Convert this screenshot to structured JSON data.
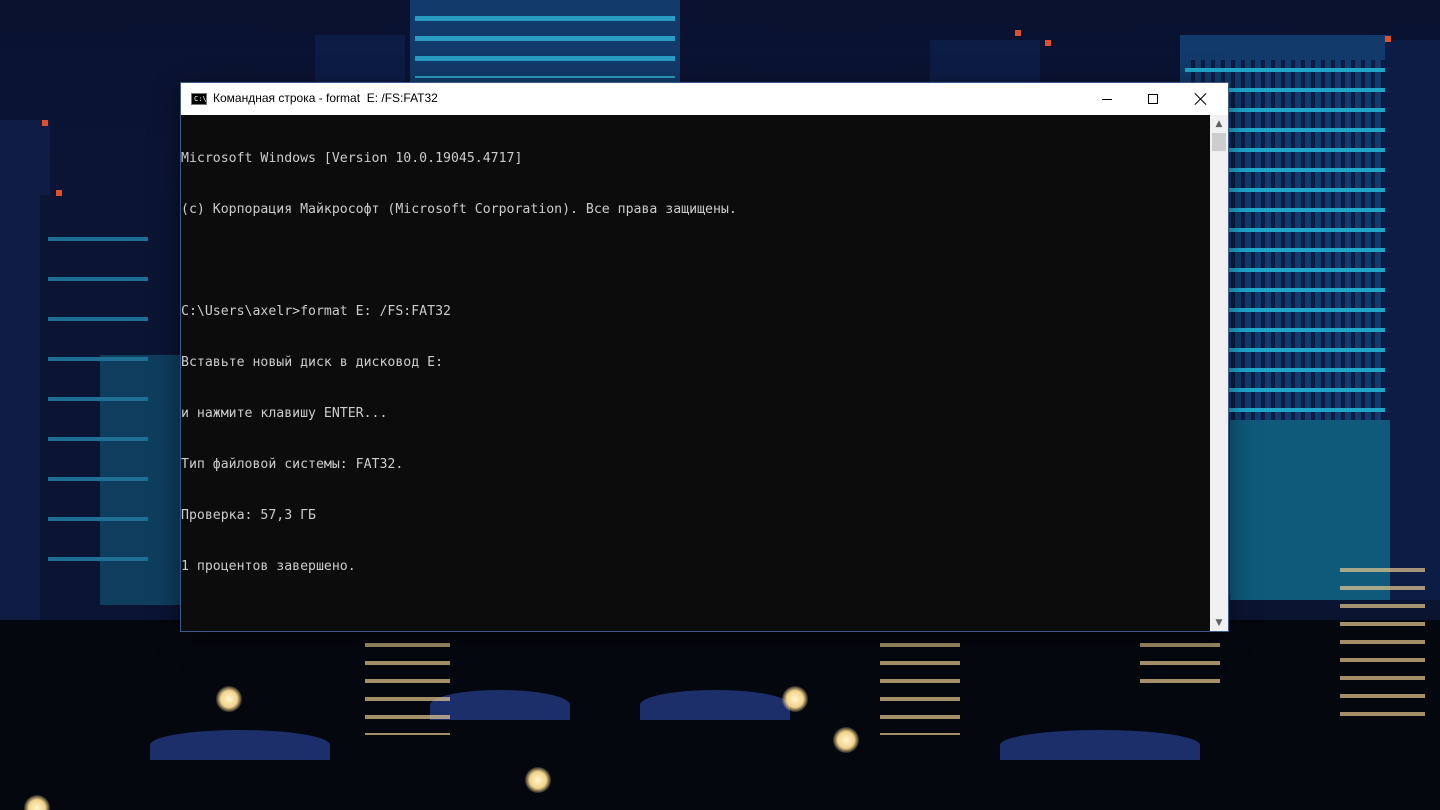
{
  "window": {
    "title": "Командная строка - format  E: /FS:FAT32",
    "icon": "cmd-icon",
    "icon_text": "C:\\"
  },
  "controls": {
    "minimize": "minimize-icon",
    "maximize": "maximize-icon",
    "close": "close-icon"
  },
  "console": {
    "lines": [
      "Microsoft Windows [Version 10.0.19045.4717]",
      "(c) Корпорация Майкрософт (Microsoft Corporation). Все права защищены.",
      "",
      "C:\\Users\\axelr>format E: /FS:FAT32",
      "Вставьте новый диск в дисковод E:",
      "и нажмите клавишу ENTER...",
      "Тип файловой системы: FAT32.",
      "Проверка: 57,3 ГБ",
      "1 процентов завершено."
    ]
  },
  "scrollbar": {
    "up": "▲",
    "down": "▼"
  },
  "colors": {
    "console_bg": "#0c0c0c",
    "console_text": "#cccccc",
    "titlebar_bg": "#ffffff"
  }
}
